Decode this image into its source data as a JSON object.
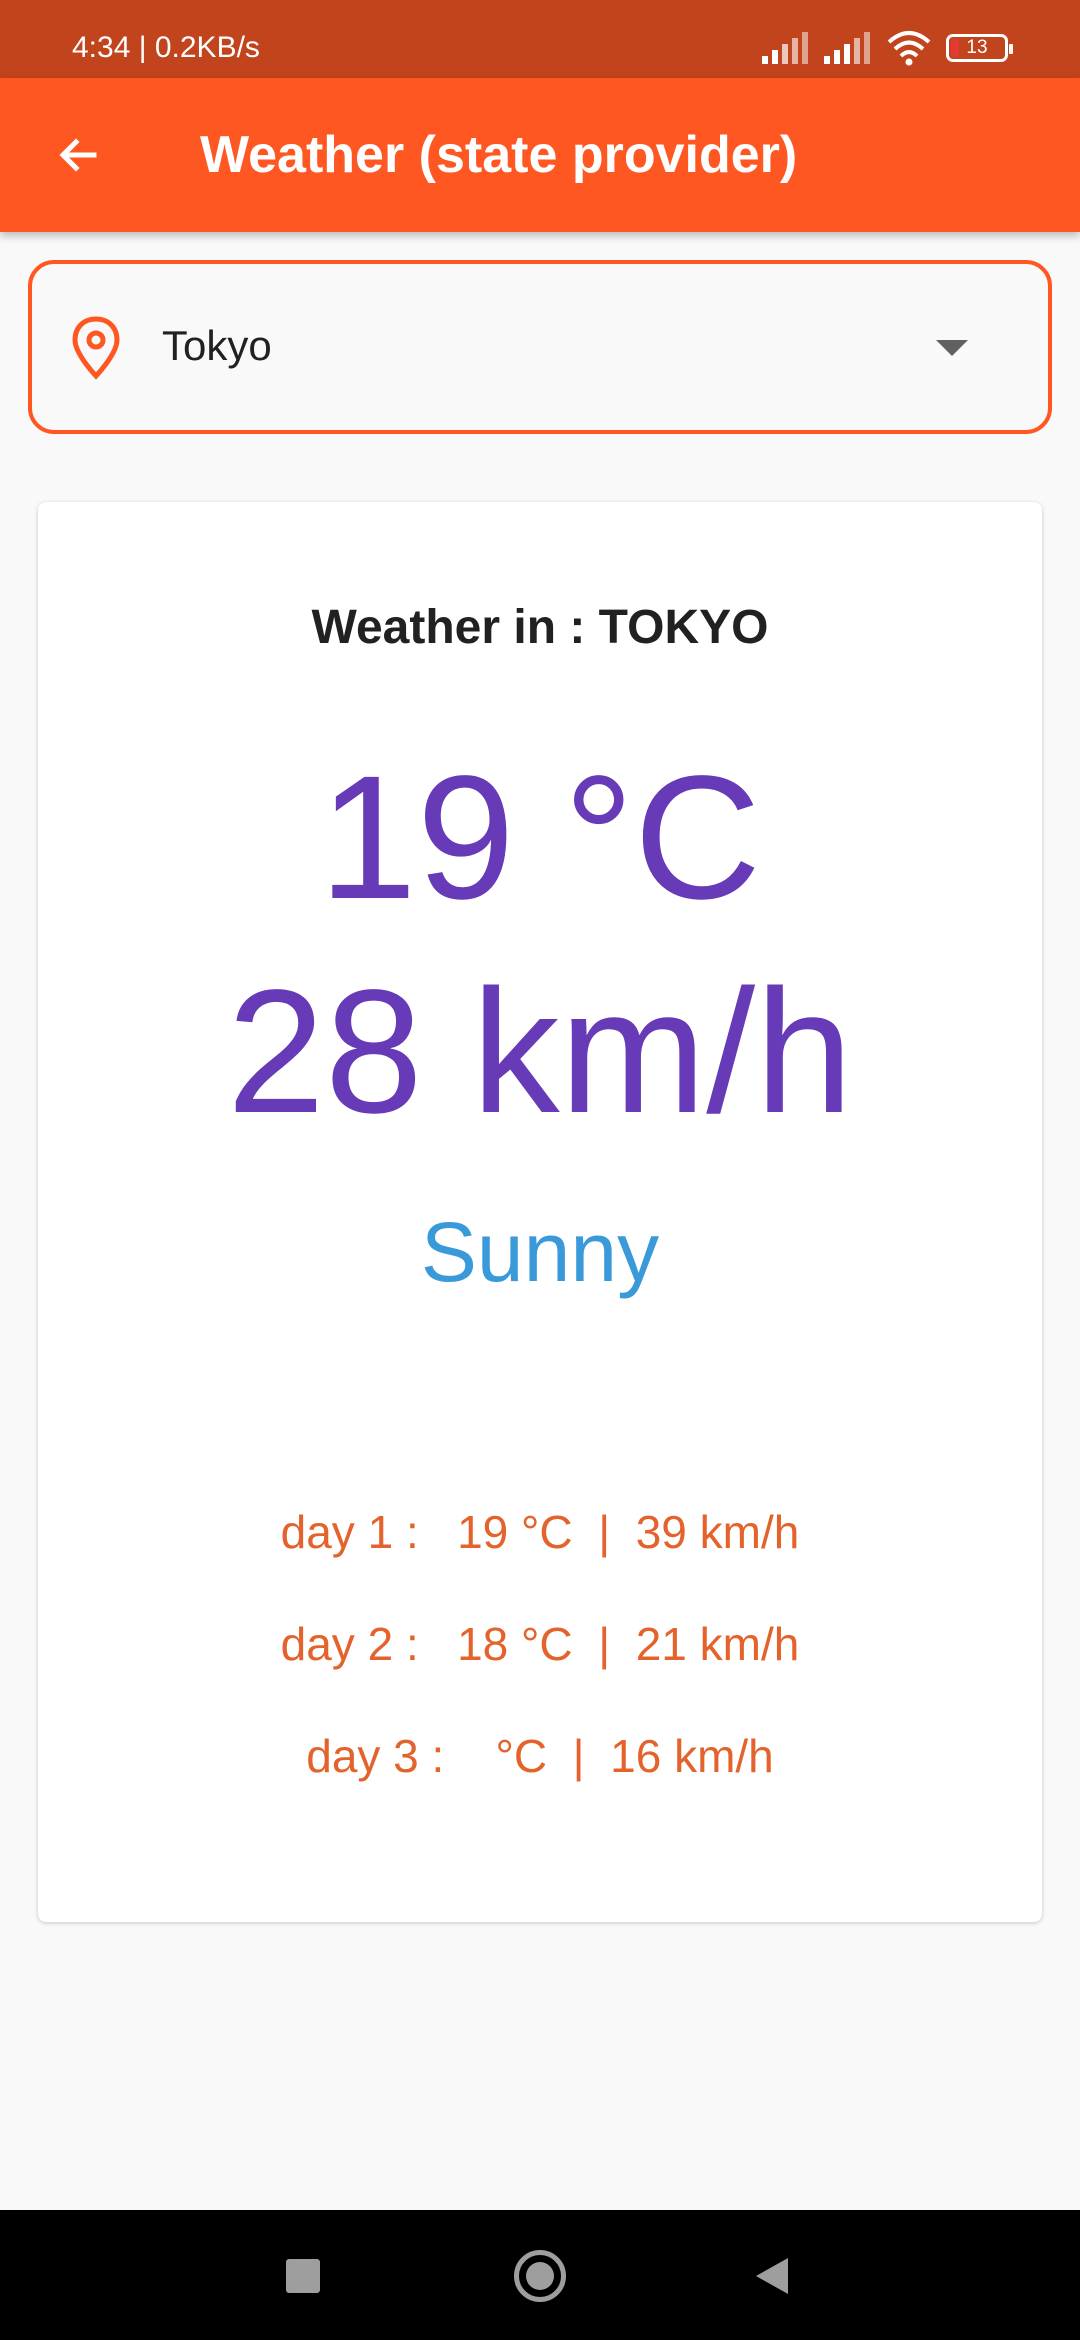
{
  "status_bar": {
    "time_speed": "4:34 | 0.2KB/s",
    "battery_level": "13"
  },
  "app_bar": {
    "title": "Weather (state provider)",
    "back_icon": "arrow-back-icon"
  },
  "city_selector": {
    "value": "Tokyo",
    "icon": "location-pin-icon",
    "dropdown_icon": "arrow-drop-down-icon"
  },
  "weather_card": {
    "title": "Weather in : TOKYO",
    "temperature": "19 °C",
    "wind": "28 km/h",
    "condition": "Sunny",
    "forecast": [
      {
        "text": "day 1 :   19 °C  |  39 km/h"
      },
      {
        "text": "day 2 :   18 °C  |  21 km/h"
      },
      {
        "text": "day 3 :    °C  |  16 km/h"
      }
    ]
  },
  "nav_bar": {
    "recents_icon": "square-recents-icon",
    "home_icon": "circle-home-icon",
    "back_icon": "triangle-back-icon"
  },
  "colors": {
    "status_bar": "#c1441c",
    "accent": "#ff5722",
    "value_purple": "#673ab7",
    "condition_blue": "#3a9ad9",
    "forecast_orange": "#e4622b"
  }
}
